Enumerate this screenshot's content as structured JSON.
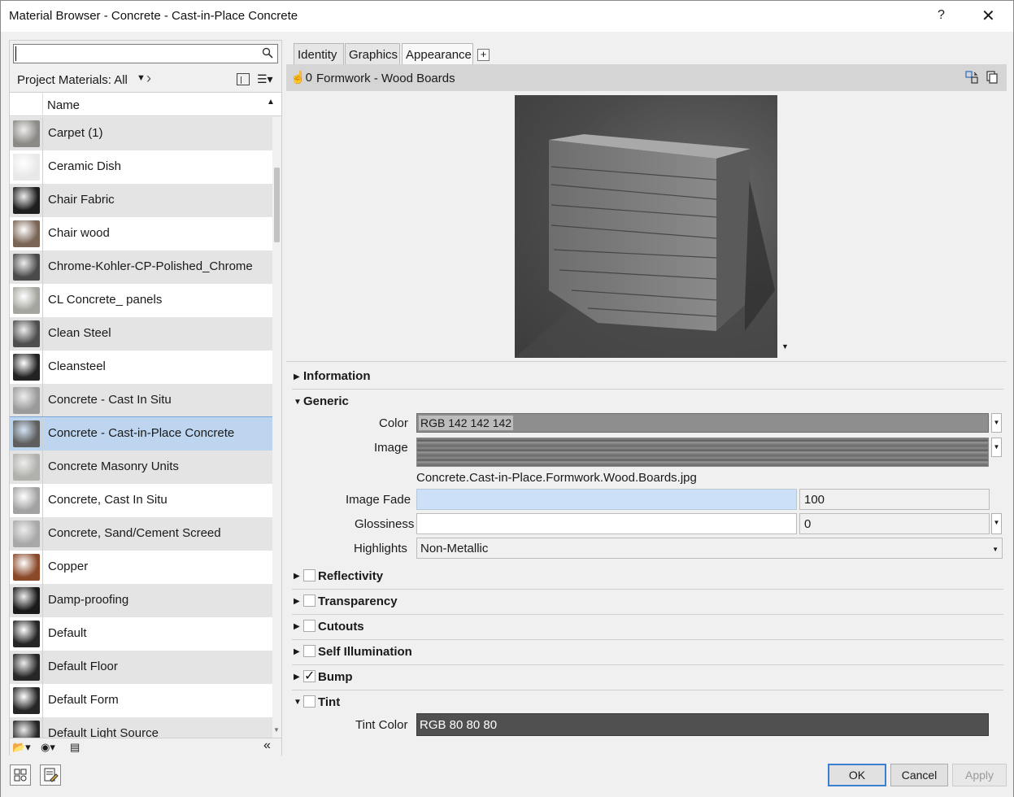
{
  "window": {
    "title": "Material Browser - Concrete - Cast-in-Place Concrete",
    "help": "?",
    "close": "✕"
  },
  "left": {
    "search": {
      "value": "",
      "placeholder": ""
    },
    "filter_label": "Project Materials: All",
    "list_header": "Name",
    "materials": [
      {
        "label": "Carpet (1)",
        "thumb": "#8c8a86"
      },
      {
        "label": "Ceramic Dish",
        "thumb": "#e8e8e8"
      },
      {
        "label": "Chair Fabric",
        "thumb": "#1e1e1e"
      },
      {
        "label": "Chair wood",
        "thumb": "#7a6555"
      },
      {
        "label": "Chrome-Kohler-CP-Polished_Chrome",
        "thumb": "#4a4a4a"
      },
      {
        "label": "CL Concrete_ panels",
        "thumb": "#a5a59f"
      },
      {
        "label": "Clean Steel",
        "thumb": "#4e4e4e"
      },
      {
        "label": "Cleansteel",
        "thumb": "#222222"
      },
      {
        "label": "Concrete - Cast In Situ",
        "thumb": "#9a9a9a"
      },
      {
        "label": "Concrete - Cast-in-Place Concrete",
        "thumb": "#5e5e5e"
      },
      {
        "label": "Concrete Masonry Units",
        "thumb": "#b0b0ac"
      },
      {
        "label": "Concrete, Cast In Situ",
        "thumb": "#a2a2a2"
      },
      {
        "label": "Concrete, Sand/Cement Screed",
        "thumb": "#a8a8a8"
      },
      {
        "label": "Copper",
        "thumb": "#8a4a2a"
      },
      {
        "label": "Damp-proofing",
        "thumb": "#1a1a1a"
      },
      {
        "label": "Default",
        "thumb": "#262626"
      },
      {
        "label": "Default Floor",
        "thumb": "#262626"
      },
      {
        "label": "Default Form",
        "thumb": "#262626"
      },
      {
        "label": "Default Light Source",
        "thumb": "#262626"
      }
    ],
    "selected_index": 9,
    "collapse_label": "«"
  },
  "tabs": [
    "Identity",
    "Graphics",
    "Appearance"
  ],
  "active_tab": "Appearance",
  "tab_add": "+",
  "asset": {
    "hand": "☝0",
    "name": "Formwork - Wood Boards"
  },
  "sections": {
    "information": "Information",
    "generic": "Generic",
    "reflectivity": "Reflectivity",
    "transparency": "Transparency",
    "cutouts": "Cutouts",
    "self_illumination": "Self Illumination",
    "bump": "Bump",
    "tint": "Tint"
  },
  "generic": {
    "color_label": "Color",
    "color_value": "RGB 142 142 142",
    "image_label": "Image",
    "image_file": "Concrete.Cast-in-Place.Formwork.Wood.Boards.jpg",
    "image_fade_label": "Image Fade",
    "image_fade_value": "100",
    "glossiness_label": "Glossiness",
    "glossiness_value": "0",
    "highlights_label": "Highlights",
    "highlights_value": "Non-Metallic"
  },
  "tint": {
    "label": "Tint Color",
    "value": "RGB 80 80 80"
  },
  "checks": {
    "reflectivity": false,
    "transparency": false,
    "cutouts": false,
    "self_illumination": false,
    "bump": true,
    "tint": false
  },
  "buttons": {
    "ok": "OK",
    "cancel": "Cancel",
    "apply": "Apply"
  }
}
